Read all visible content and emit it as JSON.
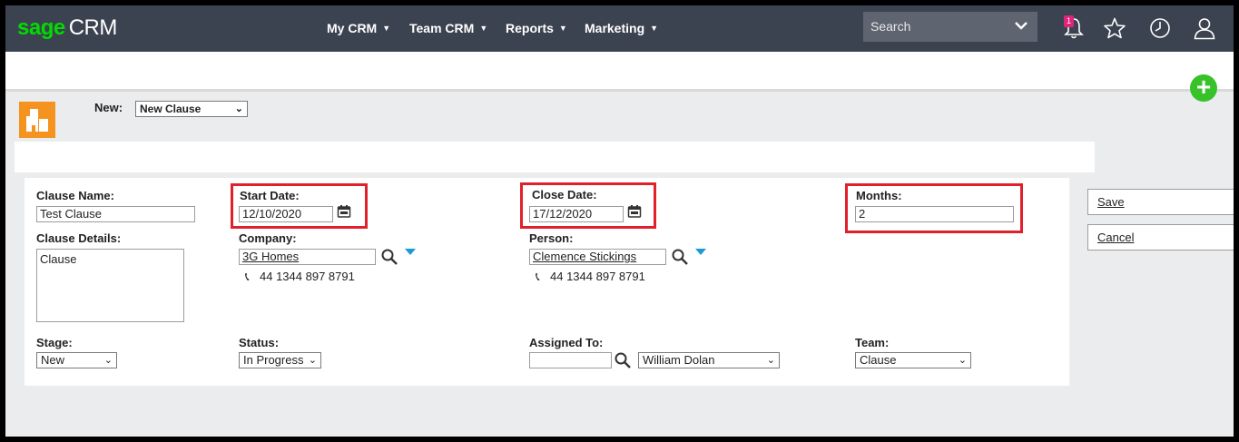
{
  "app": {
    "logo_brand": "sage",
    "logo_product": "CRM"
  },
  "nav": {
    "items": [
      {
        "label": "My CRM"
      },
      {
        "label": "Team CRM"
      },
      {
        "label": "Reports"
      },
      {
        "label": "Marketing"
      }
    ]
  },
  "search": {
    "placeholder": "Search"
  },
  "notifications": {
    "count": "1"
  },
  "new_record": {
    "label": "New:",
    "selected": "New Clause"
  },
  "form": {
    "clause_name": {
      "label": "Clause Name:",
      "value": "Test Clause"
    },
    "start_date": {
      "label": "Start Date:",
      "value": "12/10/2020"
    },
    "close_date": {
      "label": "Close Date:",
      "value": "17/12/2020"
    },
    "months": {
      "label": "Months:",
      "value": "2"
    },
    "clause_details": {
      "label": "Clause Details:",
      "value": "Clause"
    },
    "company": {
      "label": "Company:",
      "value": "3G Homes",
      "phone": "44 1344 897 8791"
    },
    "person": {
      "label": "Person:",
      "value": "Clemence Stickings",
      "phone": "44 1344 897 8791"
    },
    "stage": {
      "label": "Stage:",
      "value": "New"
    },
    "status": {
      "label": "Status:",
      "value": "In Progress"
    },
    "assigned_to": {
      "label": "Assigned To:",
      "value": "",
      "selected": "William Dolan"
    },
    "team": {
      "label": "Team:",
      "value": "Clause"
    }
  },
  "actions": {
    "save": "Save",
    "cancel": "Cancel"
  },
  "colors": {
    "topbar": "#3c4350",
    "brand_green": "#00dc00",
    "highlight": "#e0202a",
    "plus": "#37c22a",
    "entity_icon": "#f4931f"
  }
}
